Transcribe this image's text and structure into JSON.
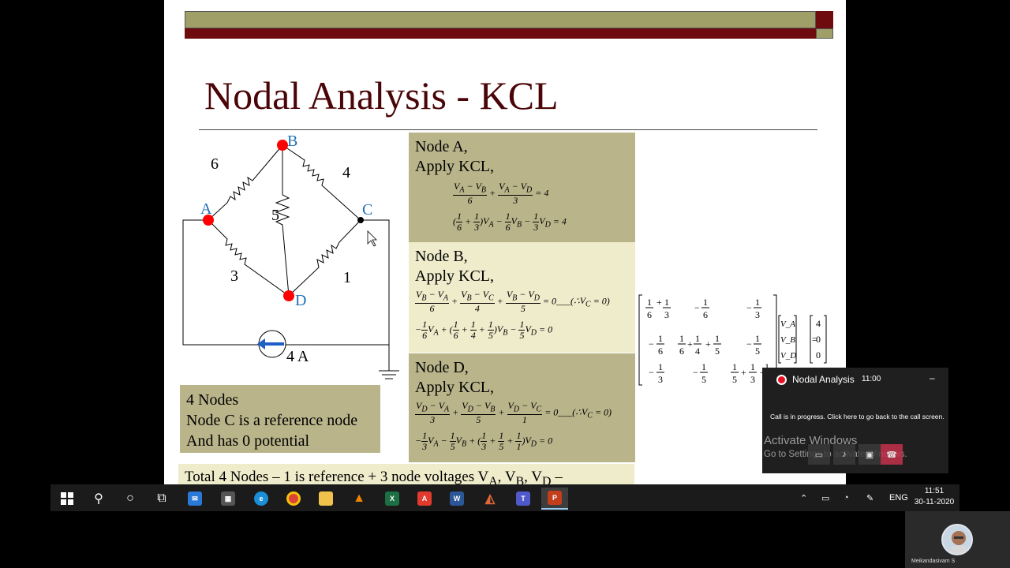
{
  "slide": {
    "title": "Nodal Analysis - KCL",
    "circuit": {
      "node_a": "A",
      "node_b": "B",
      "node_c": "C",
      "node_d": "D",
      "r_ab": "6",
      "r_bc": "4",
      "r_bd": "5",
      "r_ad": "3",
      "r_cd": "1",
      "source": "4 A"
    },
    "node_a_box": {
      "line1": "Node A,",
      "line2": "Apply KCL,",
      "eq1": "(V_A − V_B)/6 + (V_A − V_D)/3 = 4",
      "eq2": "(1/6 + 1/3)V_A − (1/6)V_B − (1/3)V_D = 4"
    },
    "node_b_box": {
      "line1": "Node B,",
      "line2": "Apply KCL,",
      "eq1": "(V_B − V_A)/6 + (V_B − V_C)/4 + (V_B − V_D)/5 = 0 ___(∴V_C = 0)",
      "eq2": "−(1/6)V_A + (1/6 + 1/4 + 1/5)V_B − (1/5)V_D = 0"
    },
    "node_d_box": {
      "line1": "Node D,",
      "line2": "Apply KCL,",
      "eq1": "(V_D − V_A)/3 + (V_D − V_B)/5 + (V_D − V_C)/1 = 0 ___(∴V_C = 0)",
      "eq2": "−(1/3)V_A − (1/5)V_B + (1/3 + 1/5 + 1/1)V_D = 0"
    },
    "nodes_note": {
      "line1": "4 Nodes",
      "line2": "Node C is a reference node",
      "line3": "And has 0 potential"
    },
    "total_line": "Total 4 Nodes – 1 is reference + 3 node voltages V",
    "total_sub_a": "A",
    "total_sep1": ", V",
    "total_sub_b": "B",
    "total_sep2": ", V",
    "total_sub_d": "D",
    "total_end": " –",
    "matrix": {
      "vector_v": [
        "V_A",
        "V_B",
        "V_D"
      ],
      "rhs": [
        "4",
        "0",
        "0"
      ]
    }
  },
  "call_popup": {
    "title": "Nodal Analysis",
    "time": "11:00",
    "minimize": "–",
    "message": "Call is in progress. Click here to go back to the call screen.",
    "watermark_line1": "Activate Windows",
    "watermark_line2": "Go to Settings to activate Windows."
  },
  "taskbar": {
    "lang": "ENG",
    "time": "11:51",
    "date": "30-11-2020"
  },
  "presenter": {
    "name": "Meikandasivam S"
  },
  "colors": {
    "title": "#4a0508",
    "olive": "#a09f68",
    "maroon": "#6d0b0f",
    "box_dark": "#b9b48a",
    "box_light": "#eeeccb",
    "node_dot": "#ff0000",
    "node_label": "#1f6fb5",
    "arrow": "#1f5fc8"
  }
}
